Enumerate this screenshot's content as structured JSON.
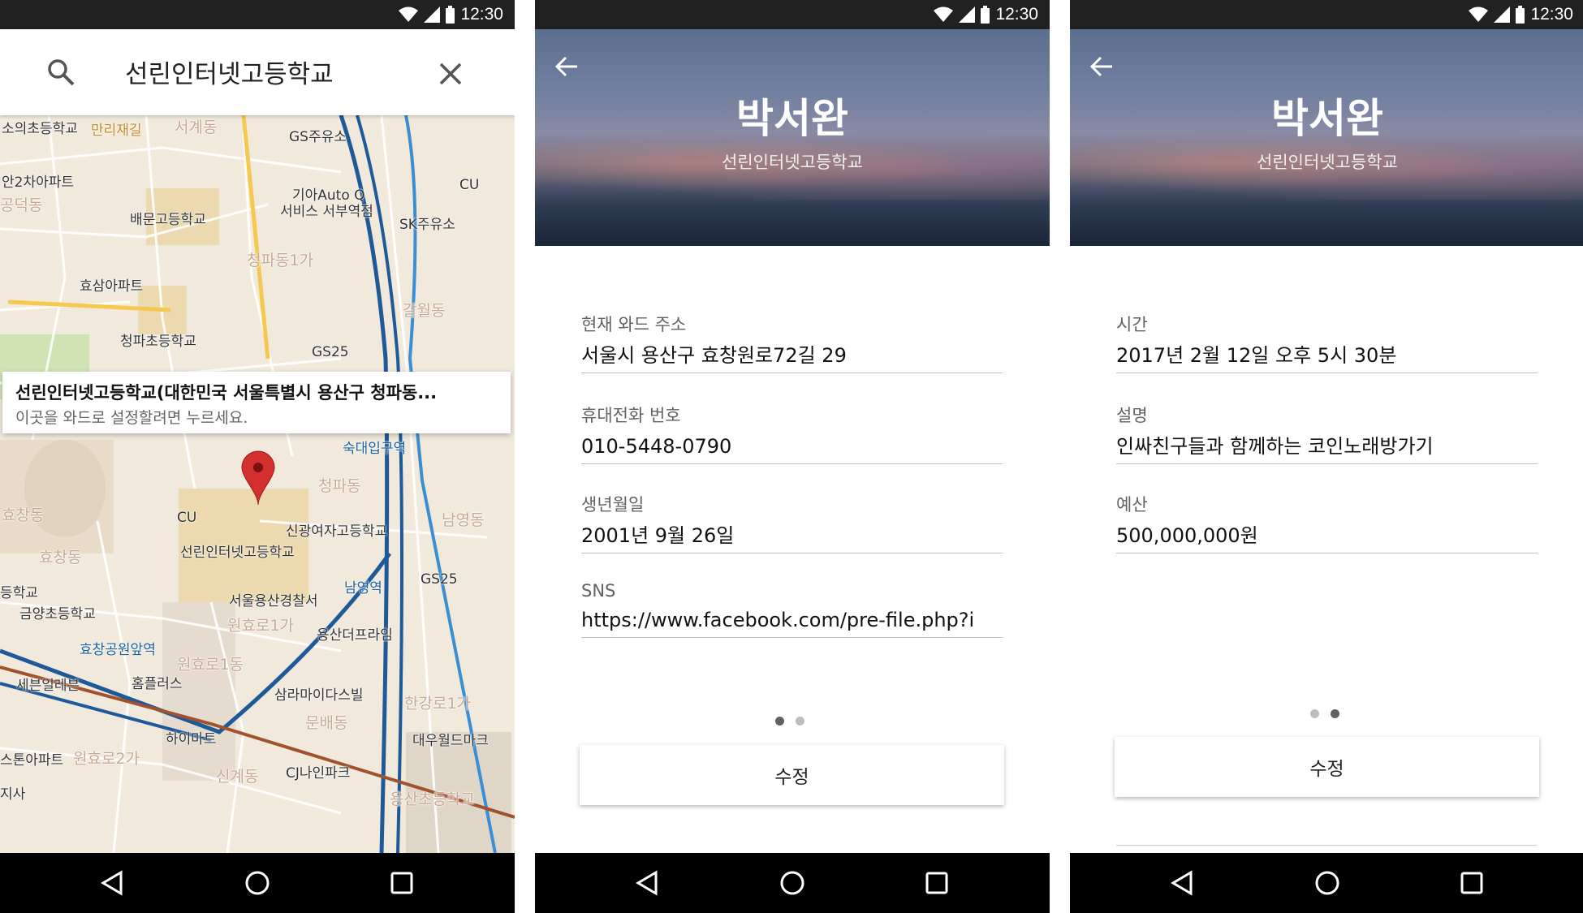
{
  "status": {
    "time": "12:30"
  },
  "map_screen": {
    "search": {
      "query": "선린인터넷고등학교",
      "search_icon": "search-icon",
      "clear_icon": "close-icon"
    },
    "info_card": {
      "title": "선린인터넷고등학교(대한민국 서울특별시 용산구 청파동...",
      "subtitle": "이곳을 와드로 설정할려면 누르세요."
    },
    "map_labels": [
      "소의초등학교",
      "만리재길",
      "서계동",
      "GS주유소",
      "안2차아파트",
      "공덕동",
      "CU",
      "기아Auto Q",
      "서비스 서부역점",
      "배문고등학교",
      "SK주유소",
      "청파동1가",
      "효삼아파트",
      "청파초등학교",
      "갈월동",
      "GS25",
      "숙대입구역",
      "청파동",
      "CU",
      "효창동",
      "효창동",
      "신광여자고등학교",
      "선린인터넷고등학교",
      "남영동",
      "등학교",
      "금양초등학교",
      "남영역",
      "GS25",
      "서울용산경찰서",
      "원효로1가",
      "용산더프라임",
      "효창공원앞역",
      "원효로1동",
      "세븐일레븐",
      "홈플러스",
      "삼라마이다스빌",
      "한강로1가",
      "문배동",
      "하이마트",
      "대우월드마크",
      "스톤아파트",
      "원효로2가",
      "신계동",
      "CJ나인파크",
      "지사",
      "용산초등학교"
    ]
  },
  "profile": {
    "name": "박서완",
    "school": "선린인터넷고등학교"
  },
  "page1": {
    "fields": [
      {
        "label": "현재 와드 주소",
        "value": "서울시 용산구 효창원로72길 29"
      },
      {
        "label": "휴대전화 번호",
        "value": "010-5448-0790"
      },
      {
        "label": "생년월일",
        "value": "2001년 9월 26일"
      },
      {
        "label": "SNS",
        "value": "https://www.facebook.com/pre-file.php?i"
      }
    ],
    "button": "수정",
    "page_indicator": {
      "current": 1,
      "total": 2
    }
  },
  "page2": {
    "fields": [
      {
        "label": "시간",
        "value": "2017년 2월 12일 오후 5시 30분"
      },
      {
        "label": "설명",
        "value": "인싸친구들과 함께하는 코인노래방가기"
      },
      {
        "label": "예산",
        "value": "500,000,000원"
      }
    ],
    "button": "수정",
    "page_indicator": {
      "current": 2,
      "total": 2
    }
  },
  "colors": {
    "accent_dark": "#212121",
    "map_pin": "#d32f2f",
    "subway_blue": "#1e5a9a",
    "map_bg": "#f1e9dc"
  }
}
